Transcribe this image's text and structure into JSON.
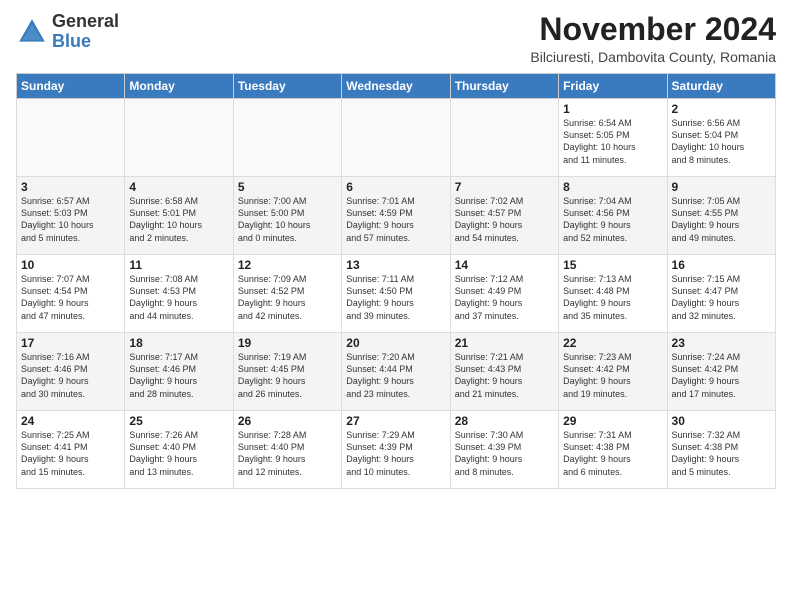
{
  "logo": {
    "text_general": "General",
    "text_blue": "Blue"
  },
  "header": {
    "month_title": "November 2024",
    "location": "Bilciuresti, Dambovita County, Romania"
  },
  "weekdays": [
    "Sunday",
    "Monday",
    "Tuesday",
    "Wednesday",
    "Thursday",
    "Friday",
    "Saturday"
  ],
  "weeks": [
    [
      {
        "day": "",
        "info": ""
      },
      {
        "day": "",
        "info": ""
      },
      {
        "day": "",
        "info": ""
      },
      {
        "day": "",
        "info": ""
      },
      {
        "day": "",
        "info": ""
      },
      {
        "day": "1",
        "info": "Sunrise: 6:54 AM\nSunset: 5:05 PM\nDaylight: 10 hours\nand 11 minutes."
      },
      {
        "day": "2",
        "info": "Sunrise: 6:56 AM\nSunset: 5:04 PM\nDaylight: 10 hours\nand 8 minutes."
      }
    ],
    [
      {
        "day": "3",
        "info": "Sunrise: 6:57 AM\nSunset: 5:03 PM\nDaylight: 10 hours\nand 5 minutes."
      },
      {
        "day": "4",
        "info": "Sunrise: 6:58 AM\nSunset: 5:01 PM\nDaylight: 10 hours\nand 2 minutes."
      },
      {
        "day": "5",
        "info": "Sunrise: 7:00 AM\nSunset: 5:00 PM\nDaylight: 10 hours\nand 0 minutes."
      },
      {
        "day": "6",
        "info": "Sunrise: 7:01 AM\nSunset: 4:59 PM\nDaylight: 9 hours\nand 57 minutes."
      },
      {
        "day": "7",
        "info": "Sunrise: 7:02 AM\nSunset: 4:57 PM\nDaylight: 9 hours\nand 54 minutes."
      },
      {
        "day": "8",
        "info": "Sunrise: 7:04 AM\nSunset: 4:56 PM\nDaylight: 9 hours\nand 52 minutes."
      },
      {
        "day": "9",
        "info": "Sunrise: 7:05 AM\nSunset: 4:55 PM\nDaylight: 9 hours\nand 49 minutes."
      }
    ],
    [
      {
        "day": "10",
        "info": "Sunrise: 7:07 AM\nSunset: 4:54 PM\nDaylight: 9 hours\nand 47 minutes."
      },
      {
        "day": "11",
        "info": "Sunrise: 7:08 AM\nSunset: 4:53 PM\nDaylight: 9 hours\nand 44 minutes."
      },
      {
        "day": "12",
        "info": "Sunrise: 7:09 AM\nSunset: 4:52 PM\nDaylight: 9 hours\nand 42 minutes."
      },
      {
        "day": "13",
        "info": "Sunrise: 7:11 AM\nSunset: 4:50 PM\nDaylight: 9 hours\nand 39 minutes."
      },
      {
        "day": "14",
        "info": "Sunrise: 7:12 AM\nSunset: 4:49 PM\nDaylight: 9 hours\nand 37 minutes."
      },
      {
        "day": "15",
        "info": "Sunrise: 7:13 AM\nSunset: 4:48 PM\nDaylight: 9 hours\nand 35 minutes."
      },
      {
        "day": "16",
        "info": "Sunrise: 7:15 AM\nSunset: 4:47 PM\nDaylight: 9 hours\nand 32 minutes."
      }
    ],
    [
      {
        "day": "17",
        "info": "Sunrise: 7:16 AM\nSunset: 4:46 PM\nDaylight: 9 hours\nand 30 minutes."
      },
      {
        "day": "18",
        "info": "Sunrise: 7:17 AM\nSunset: 4:46 PM\nDaylight: 9 hours\nand 28 minutes."
      },
      {
        "day": "19",
        "info": "Sunrise: 7:19 AM\nSunset: 4:45 PM\nDaylight: 9 hours\nand 26 minutes."
      },
      {
        "day": "20",
        "info": "Sunrise: 7:20 AM\nSunset: 4:44 PM\nDaylight: 9 hours\nand 23 minutes."
      },
      {
        "day": "21",
        "info": "Sunrise: 7:21 AM\nSunset: 4:43 PM\nDaylight: 9 hours\nand 21 minutes."
      },
      {
        "day": "22",
        "info": "Sunrise: 7:23 AM\nSunset: 4:42 PM\nDaylight: 9 hours\nand 19 minutes."
      },
      {
        "day": "23",
        "info": "Sunrise: 7:24 AM\nSunset: 4:42 PM\nDaylight: 9 hours\nand 17 minutes."
      }
    ],
    [
      {
        "day": "24",
        "info": "Sunrise: 7:25 AM\nSunset: 4:41 PM\nDaylight: 9 hours\nand 15 minutes."
      },
      {
        "day": "25",
        "info": "Sunrise: 7:26 AM\nSunset: 4:40 PM\nDaylight: 9 hours\nand 13 minutes."
      },
      {
        "day": "26",
        "info": "Sunrise: 7:28 AM\nSunset: 4:40 PM\nDaylight: 9 hours\nand 12 minutes."
      },
      {
        "day": "27",
        "info": "Sunrise: 7:29 AM\nSunset: 4:39 PM\nDaylight: 9 hours\nand 10 minutes."
      },
      {
        "day": "28",
        "info": "Sunrise: 7:30 AM\nSunset: 4:39 PM\nDaylight: 9 hours\nand 8 minutes."
      },
      {
        "day": "29",
        "info": "Sunrise: 7:31 AM\nSunset: 4:38 PM\nDaylight: 9 hours\nand 6 minutes."
      },
      {
        "day": "30",
        "info": "Sunrise: 7:32 AM\nSunset: 4:38 PM\nDaylight: 9 hours\nand 5 minutes."
      }
    ]
  ]
}
